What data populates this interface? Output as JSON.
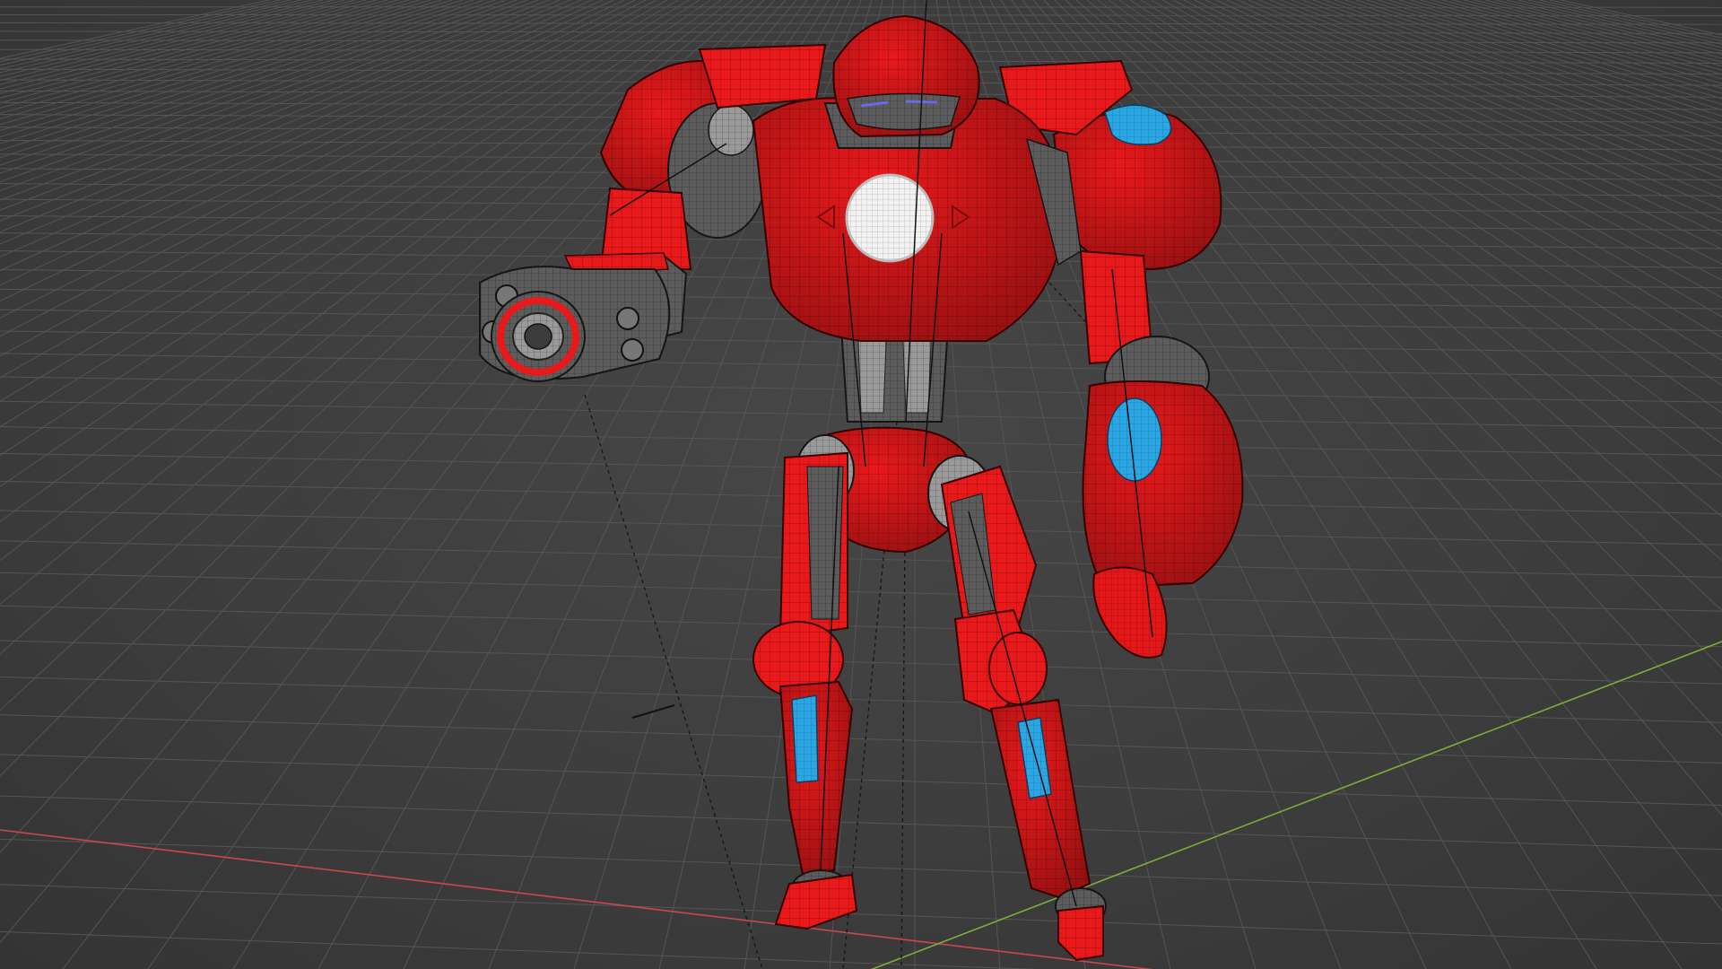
{
  "viewport": {
    "mode": "3d-viewport",
    "shading": "wireframe-over-solid",
    "background_color": "#3d3d3d",
    "grid_color": "#555555",
    "x_axis_color": "#c8494c",
    "y_axis_color": "#7cae38"
  },
  "model": {
    "subject": "robot-mech",
    "primary_color": "#e8191b",
    "secondary_color": "#5c5c5c",
    "accent_color": "#2ba6e3",
    "glow_color": "#ffffff"
  }
}
